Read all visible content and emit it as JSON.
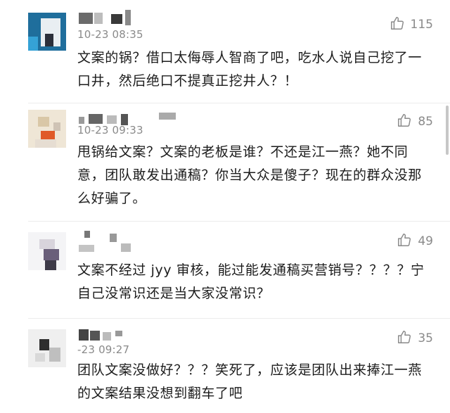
{
  "comments": [
    {
      "time": "10-23 08:35",
      "likes": "115",
      "text": "文案的锅？借口太侮辱人智商了吧，吃水人说自己挖了一口井，然后绝口不提真正挖井人？！"
    },
    {
      "time": "10-23 09:33",
      "likes": "85",
      "text": "甩锅给文案？文案的老板是谁？不还是江一燕？她不同意，团队敢发出通稿？你当大众是傻子？现在的群众没那么好骗了。"
    },
    {
      "time": "",
      "likes": "49",
      "text": "文案不经过 jyy 审核，能过能发通稿买营销号？？？？宁自己没常识还是当大家没常识？"
    },
    {
      "time": "-23 09:27",
      "likes": "35",
      "text": "团队文案没做好？？？笑死了，应该是团队出来捧江一燕的文案结果没想到翻车了吧"
    }
  ],
  "colors": {
    "meta": "#8a8a8a",
    "text": "#1c1c1c",
    "divider": "#ececec"
  },
  "icons": {
    "like": "thumbs-up-icon"
  }
}
